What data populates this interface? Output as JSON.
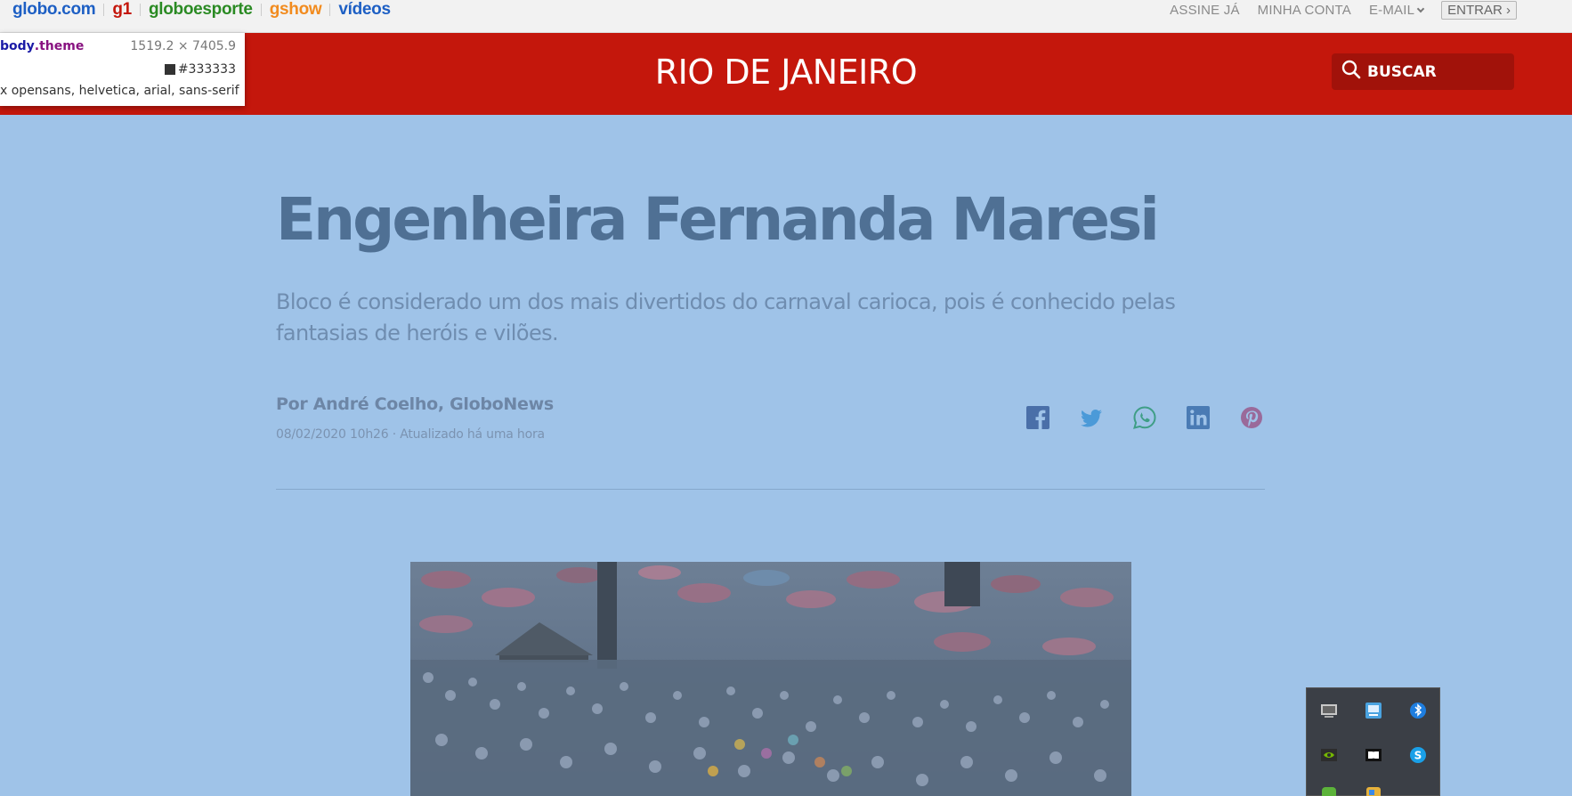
{
  "topbar": {
    "brands": [
      {
        "label": "globo.com",
        "color": "#1d5fc4"
      },
      {
        "label": "g1",
        "color": "#c4170c"
      },
      {
        "label": "globoesporte",
        "color": "#2a8a23"
      },
      {
        "label": "gshow",
        "color": "#f28b1e"
      },
      {
        "label": "vídeos",
        "color": "#1d5fc4"
      }
    ],
    "links": {
      "subscribe": "ASSINE JÁ",
      "account": "MINHA CONTA",
      "email": "E-MAIL",
      "enter": "ENTRAR ›"
    }
  },
  "header": {
    "region": "RIO DE JANEIRO",
    "search_label": "BUSCAR",
    "color": "#c4170c"
  },
  "devtools_tooltip": {
    "selector_tag": "body",
    "selector_class": ".theme",
    "dimensions": "1519.2 × 7405.9",
    "color": "#333333",
    "font": "x opensans, helvetica, arial, sans-serif"
  },
  "article": {
    "title": "Engenheira Fernanda Maresi",
    "subtitle": "Bloco é considerado um dos mais divertidos do carnaval carioca, pois é conhecido pelas fantasias de heróis e vilões.",
    "byline": "Por André Coelho, GloboNews",
    "dateline": "08/02/2020 10h26 · Atualizado há uma hora",
    "share_icons": [
      "facebook-icon",
      "twitter-icon",
      "whatsapp-icon",
      "linkedin-icon",
      "pinterest-icon"
    ]
  },
  "tray": {
    "icons": [
      "display-icon",
      "network-settings-icon",
      "bluetooth-icon",
      "nvidia-icon",
      "dolby-icon",
      "skype-icon",
      "green-app-icon",
      "yellow-app-icon"
    ]
  }
}
